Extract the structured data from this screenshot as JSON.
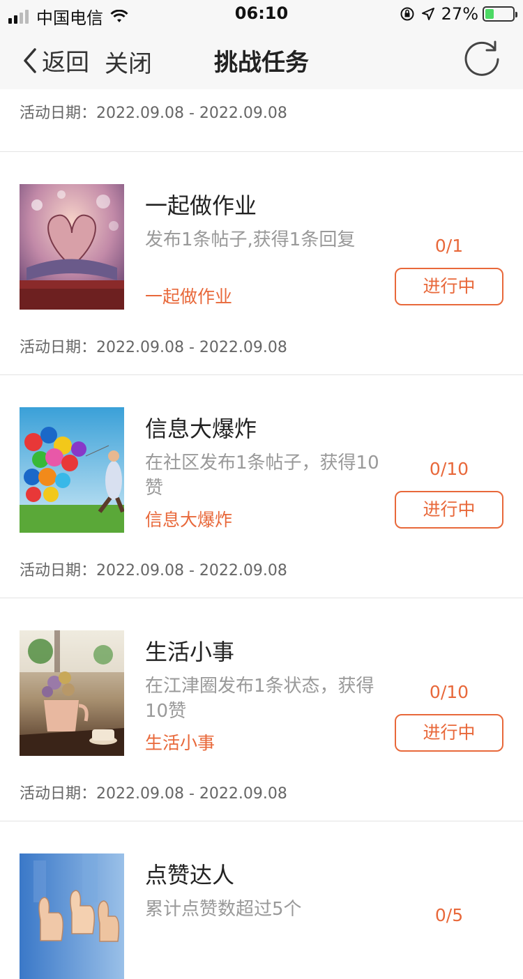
{
  "status": {
    "carrier": "中国电信",
    "time": "06:10",
    "battery": "27%"
  },
  "nav": {
    "back_label": "返回",
    "close_label": "关闭",
    "title": "挑战任务"
  },
  "date_label": "活动日期：",
  "partial_date": "2022.09.08 - 2022.09.08",
  "tasks": [
    {
      "title": "一起做作业",
      "description": "发布1条帖子,获得1条回复",
      "tag": "一起做作业",
      "progress": "0/1",
      "status": "进行中",
      "date": "2022.09.08 - 2022.09.08",
      "image": "open-book-heart-image"
    },
    {
      "title": "信息大爆炸",
      "description": "在社区发布1条帖子，获得10赞",
      "tag": "信息大爆炸",
      "progress": "0/10",
      "status": "进行中",
      "date": "2022.09.08 - 2022.09.08",
      "image": "balloons-image"
    },
    {
      "title": "生活小事",
      "description": "在江津圈发布1条状态，获得10赞",
      "tag": "生活小事",
      "progress": "0/10",
      "status": "进行中",
      "date": "2022.09.08 - 2022.09.08",
      "image": "flower-teapot-image"
    },
    {
      "title": "点赞达人",
      "description": "累计点赞数超过5个",
      "progress": "0/5",
      "image": "thumbs-up-image"
    }
  ],
  "colors": {
    "accent": "#e8683a",
    "nav_bg": "#f7f7f7"
  }
}
